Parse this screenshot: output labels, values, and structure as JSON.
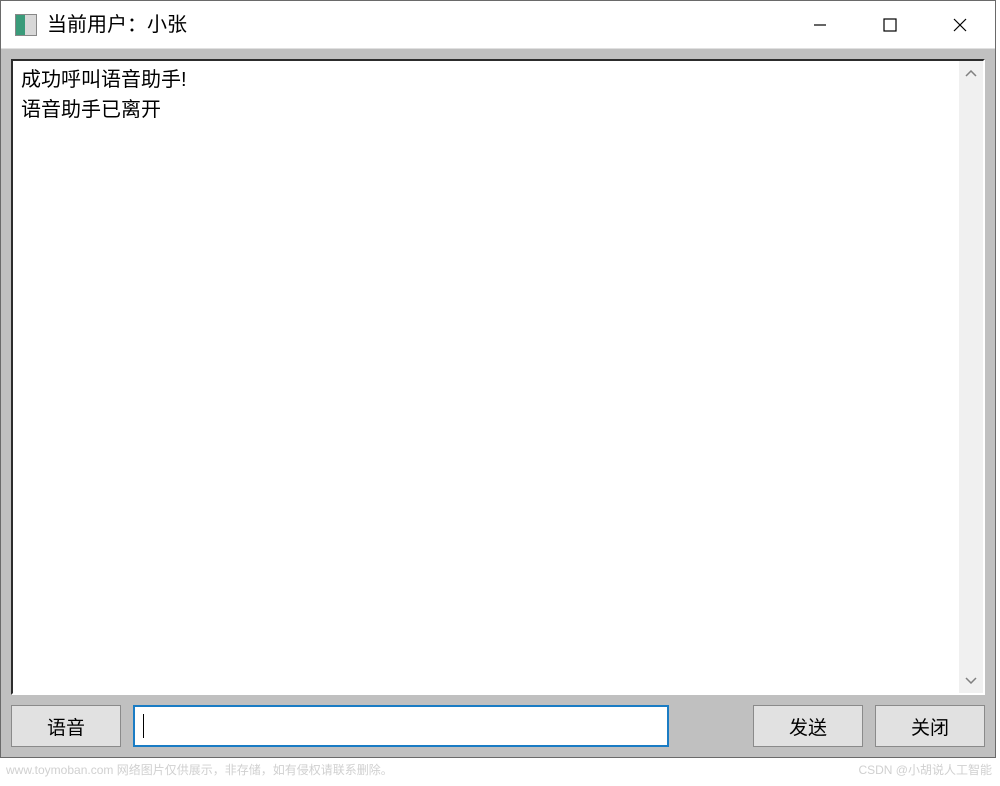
{
  "window": {
    "title": "当前用户：小张"
  },
  "output": {
    "lines": "成功呼叫语音助手!\n语音助手已离开"
  },
  "input": {
    "value": ""
  },
  "buttons": {
    "voice": "语音",
    "send": "发送",
    "close": "关闭"
  },
  "watermark": {
    "left": "www.toymoban.com 网络图片仅供展示，非存储，如有侵权请联系删除。",
    "right": "CSDN @小胡说人工智能"
  }
}
